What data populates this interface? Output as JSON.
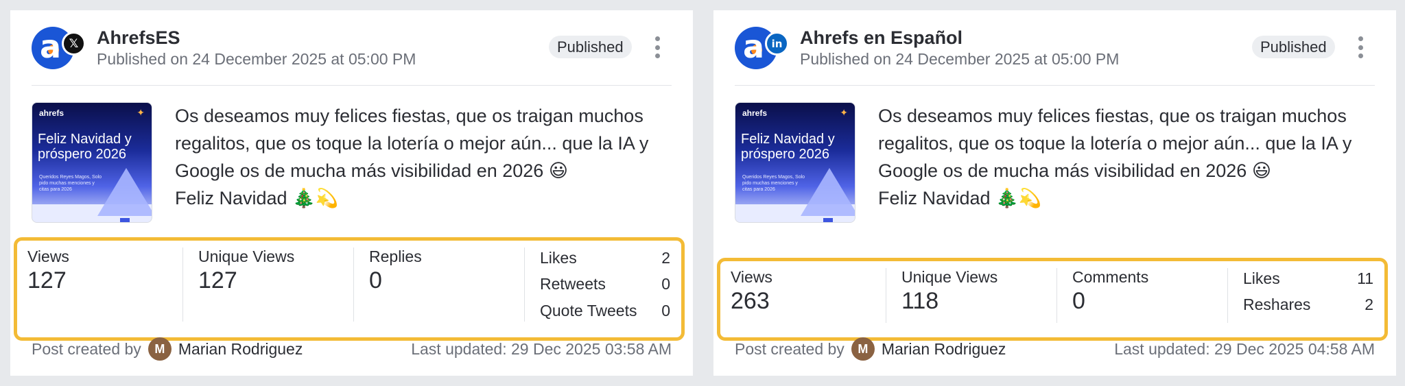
{
  "cards": [
    {
      "account_name": "AhrefsES",
      "network_icon": "x-icon",
      "network_glyph": "𝕏",
      "published_on": "Published on 24 December 2025 at 05:00 PM",
      "status": "Published",
      "avatar_glyph": "a",
      "thumbnail": {
        "brand": "ahrefs",
        "title": "Feliz Navidad y próspero 2026",
        "subtitle": "Queridos Reyes Magos, Solo pido muchas menciones y citas para 2026"
      },
      "post_lines": [
        "Os deseamos muy felices fiestas, que os traigan muchos",
        "regalitos, que os toque la lotería o mejor aún... que la IA y",
        "Google os de mucha más visibilidad en 2026 😃",
        "Feliz Navidad 🎄💫"
      ],
      "metrics": [
        {
          "label": "Views",
          "value": "127"
        },
        {
          "label": "Unique Views",
          "value": "127"
        },
        {
          "label": "Replies",
          "value": "0"
        }
      ],
      "side_metrics": [
        {
          "label": "Likes",
          "value": "2"
        },
        {
          "label": "Retweets",
          "value": "0"
        },
        {
          "label": "Quote Tweets",
          "value": "0"
        }
      ],
      "created_by_label": "Post created by",
      "author_initial": "M",
      "author_name": "Marian Rodriguez",
      "last_updated": "Last updated: 29 Dec 2025 03:58 AM"
    },
    {
      "account_name": "Ahrefs en Español",
      "network_icon": "linkedin-icon",
      "network_glyph": "in",
      "published_on": "Published on 24 December 2025 at 05:00 PM",
      "status": "Published",
      "avatar_glyph": "a",
      "thumbnail": {
        "brand": "ahrefs",
        "title": "Feliz Navidad y próspero 2026",
        "subtitle": "Queridos Reyes Magos, Solo pido muchas menciones y citas para 2026"
      },
      "post_lines": [
        "Os deseamos muy felices fiestas, que os traigan muchos",
        "regalitos, que os toque la lotería o mejor aún... que la IA y",
        "Google os de mucha más visibilidad en 2026 😃",
        "Feliz Navidad 🎄💫"
      ],
      "metrics": [
        {
          "label": "Views",
          "value": "263"
        },
        {
          "label": "Unique Views",
          "value": "118"
        },
        {
          "label": "Comments",
          "value": "0"
        }
      ],
      "side_metrics": [
        {
          "label": "Likes",
          "value": "11"
        },
        {
          "label": "Reshares",
          "value": "2"
        }
      ],
      "created_by_label": "Post created by",
      "author_initial": "M",
      "author_name": "Marian Rodriguez",
      "last_updated": "Last updated: 29 Dec 2025 04:58 AM"
    }
  ],
  "colors": {
    "page_bg": "#e7e9ec",
    "highlight_border": "#f3bb36",
    "brand_blue": "#1a56d6",
    "brand_orange": "#ff8a1e",
    "linkedin_blue": "#0a66c2"
  }
}
